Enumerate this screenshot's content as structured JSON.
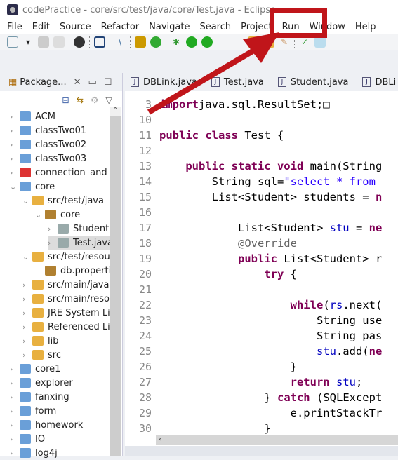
{
  "window": {
    "title": "codePractice - core/src/test/java/core/Test.java - Eclipse"
  },
  "menu": [
    "File",
    "Edit",
    "Source",
    "Refactor",
    "Navigate",
    "Search",
    "Project",
    "Run",
    "Window",
    "Help"
  ],
  "package_explorer": {
    "title": "Package...",
    "items": [
      {
        "label": "ACM",
        "depth": 0,
        "state": "collapsed"
      },
      {
        "label": "classTwo01",
        "depth": 0,
        "state": "collapsed"
      },
      {
        "label": "classTwo02",
        "depth": 0,
        "state": "collapsed"
      },
      {
        "label": "classTwo03",
        "depth": 0,
        "state": "collapsed"
      },
      {
        "label": "connection_and_m",
        "depth": 0,
        "state": "collapsed",
        "error": true
      },
      {
        "label": "core",
        "depth": 0,
        "state": "expanded"
      },
      {
        "label": "src/test/java",
        "depth": 1,
        "state": "expanded"
      },
      {
        "label": "core",
        "depth": 2,
        "state": "expanded"
      },
      {
        "label": "Student.j",
        "depth": 3,
        "state": "collapsed"
      },
      {
        "label": "Test.java",
        "depth": 3,
        "state": "collapsed",
        "selected": true
      },
      {
        "label": "src/test/resour",
        "depth": 1,
        "state": "expanded"
      },
      {
        "label": "db.properti",
        "depth": 2,
        "state": "leaf"
      },
      {
        "label": "src/main/java",
        "depth": 1,
        "state": "collapsed"
      },
      {
        "label": "src/main/resou",
        "depth": 1,
        "state": "collapsed"
      },
      {
        "label": "JRE System Lib",
        "depth": 1,
        "state": "collapsed"
      },
      {
        "label": "Referenced Lib",
        "depth": 1,
        "state": "collapsed"
      },
      {
        "label": "lib",
        "depth": 1,
        "state": "collapsed"
      },
      {
        "label": "src",
        "depth": 1,
        "state": "collapsed"
      },
      {
        "label": "core1",
        "depth": 0,
        "state": "collapsed"
      },
      {
        "label": "explorer",
        "depth": 0,
        "state": "collapsed"
      },
      {
        "label": "fanxing",
        "depth": 0,
        "state": "collapsed"
      },
      {
        "label": "form",
        "depth": 0,
        "state": "collapsed"
      },
      {
        "label": "homework",
        "depth": 0,
        "state": "collapsed"
      },
      {
        "label": "IO",
        "depth": 0,
        "state": "collapsed"
      },
      {
        "label": "log4j",
        "depth": 0,
        "state": "collapsed"
      }
    ]
  },
  "editor": {
    "tabs": [
      "DBLink.java",
      "Test.java",
      "Student.java",
      "DBLi"
    ],
    "lines": [
      {
        "n": "3",
        "t": [
          [
            "kw",
            "import"
          ],
          [
            "",
            "java.sql.ResultSet;□"
          ]
        ]
      },
      {
        "n": "10",
        "t": []
      },
      {
        "n": "11",
        "t": [
          [
            "kw",
            "public class"
          ],
          [
            "",
            " Test {"
          ]
        ]
      },
      {
        "n": "12",
        "t": []
      },
      {
        "n": "13",
        "t": [
          [
            "",
            "    "
          ],
          [
            "kw",
            "public static void"
          ],
          [
            "",
            " main(String"
          ]
        ]
      },
      {
        "n": "14",
        "t": [
          [
            "",
            "        String sql="
          ],
          [
            "str",
            "\"select * from"
          ]
        ]
      },
      {
        "n": "15",
        "t": [
          [
            "",
            "        List<Student> students = "
          ],
          [
            "kw",
            "n"
          ]
        ]
      },
      {
        "n": "16",
        "t": []
      },
      {
        "n": "17",
        "t": [
          [
            "",
            "            List<Student> "
          ],
          [
            "fld",
            "stu"
          ],
          [
            "",
            " = "
          ],
          [
            "kw",
            "ne"
          ]
        ]
      },
      {
        "n": "18",
        "t": [
          [
            "ann",
            "            @Override"
          ]
        ]
      },
      {
        "n": "19",
        "t": [
          [
            "",
            "            "
          ],
          [
            "kw",
            "public"
          ],
          [
            "",
            " List<Student> r"
          ]
        ]
      },
      {
        "n": "20",
        "t": [
          [
            "",
            "                "
          ],
          [
            "kw",
            "try"
          ],
          [
            "",
            " {"
          ]
        ]
      },
      {
        "n": "21",
        "t": []
      },
      {
        "n": "22",
        "t": [
          [
            "",
            "                    "
          ],
          [
            "kw",
            "while"
          ],
          [
            "",
            "("
          ],
          [
            "fld",
            "rs"
          ],
          [
            "",
            ".next("
          ]
        ]
      },
      {
        "n": "23",
        "t": [
          [
            "",
            "                        String use"
          ]
        ]
      },
      {
        "n": "24",
        "t": [
          [
            "",
            "                        String pas"
          ]
        ]
      },
      {
        "n": "25",
        "t": [
          [
            "",
            "                        "
          ],
          [
            "fld",
            "stu"
          ],
          [
            "",
            ".add("
          ],
          [
            "kw",
            "ne"
          ]
        ]
      },
      {
        "n": "26",
        "t": [
          [
            "",
            "                    }"
          ]
        ]
      },
      {
        "n": "27",
        "t": [
          [
            "",
            "                    "
          ],
          [
            "kw",
            "return"
          ],
          [
            "",
            " "
          ],
          [
            "fld",
            "stu"
          ],
          [
            "",
            ";"
          ]
        ]
      },
      {
        "n": "28",
        "t": [
          [
            "",
            "                } "
          ],
          [
            "kw",
            "catch"
          ],
          [
            "",
            " (SQLExcept"
          ]
        ]
      },
      {
        "n": "29",
        "t": [
          [
            "",
            "                    e.printStackTr"
          ]
        ]
      },
      {
        "n": "30",
        "t": [
          [
            "",
            "                }"
          ]
        ]
      }
    ]
  },
  "annotation": {
    "color": "#c0151a",
    "target": "Window"
  }
}
